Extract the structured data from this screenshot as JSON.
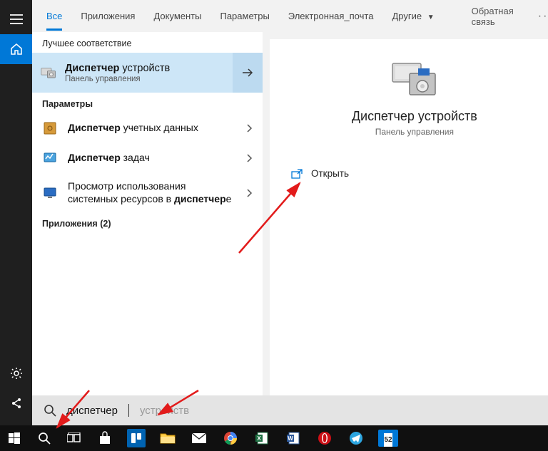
{
  "tabs": {
    "all": "Все",
    "apps": "Приложения",
    "docs": "Документы",
    "settings": "Параметры",
    "email": "Электронная_почта",
    "other": "Другие",
    "feedback": "Обратная связь"
  },
  "sections": {
    "best_match": "Лучшее соответствие",
    "settings": "Параметры",
    "apps_header": "Приложения (2)"
  },
  "best": {
    "title_bold": "Диспетчер",
    "title_rest": " устройств",
    "subtitle": "Панель управления"
  },
  "results": {
    "r1_bold": "Диспетчер",
    "r1_rest": " учетных данных",
    "r2_bold": "Диспетчер",
    "r2_rest": " задач",
    "r3_pre": "Просмотр использования системных ресурсов в ",
    "r3_bold": "диспетчер",
    "r3_post": "е"
  },
  "preview": {
    "title": "Диспетчер устройств",
    "subtitle": "Панель управления",
    "open": "Открыть"
  },
  "search": {
    "typed": "диспетчер",
    "ghost": "устройств"
  },
  "taskbar": {
    "calendar_badge": "52"
  }
}
